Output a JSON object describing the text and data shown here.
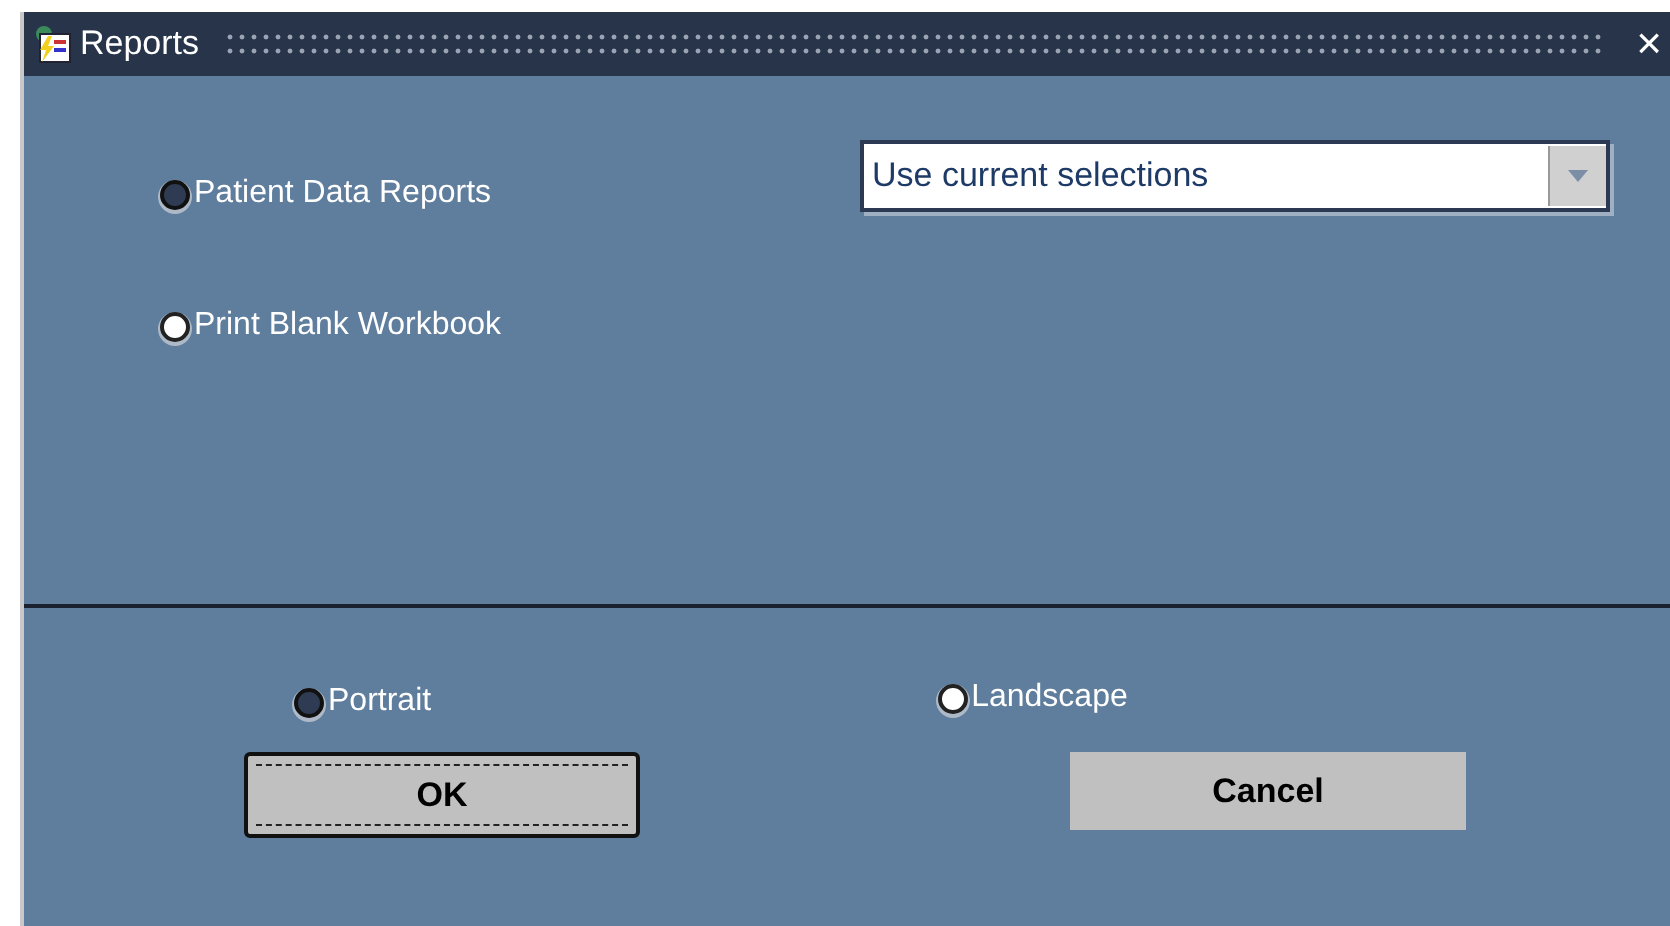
{
  "window": {
    "title": "Reports",
    "close": "×"
  },
  "report_types": [
    {
      "label": "Patient Data Reports",
      "selected": true
    },
    {
      "label": "Print Blank Workbook",
      "selected": false
    }
  ],
  "selection_dropdown": {
    "value": "Use current selections"
  },
  "orientation": [
    {
      "label": "Portrait",
      "selected": true
    },
    {
      "label": "Landscape",
      "selected": false
    }
  ],
  "buttons": [
    {
      "label": "OK",
      "focused": true
    },
    {
      "label": "Cancel",
      "focused": false
    }
  ]
}
